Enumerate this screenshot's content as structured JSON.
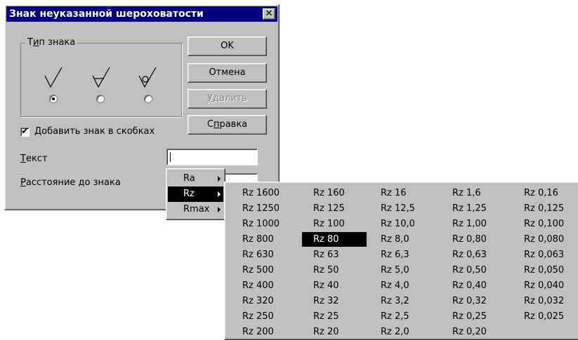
{
  "dialog": {
    "title": "Знак неуказанной шероховатости",
    "close_glyph": "✕",
    "group": {
      "label_before": "Т",
      "label_accel": "и",
      "label_after": "п знака",
      "selected_index": 0
    },
    "buttons": {
      "ok": "OK",
      "cancel": "Отмена",
      "delete_accel": "У",
      "delete_rest": "далить",
      "help_before": "С",
      "help_accel": "п",
      "help_after": "равка"
    },
    "checkbox": {
      "checked": true,
      "mark": "✔",
      "label_accel": "Д",
      "label_rest": "обавить знак в скобках"
    },
    "text_field": {
      "label_accel": "Т",
      "label_rest": "екст",
      "value": ""
    },
    "distance_field": {
      "label_accel": "Р",
      "label_rest": "асстояние до знака",
      "value": ""
    }
  },
  "menu": {
    "items": [
      "Ra",
      "Rz",
      "Rmax"
    ],
    "selected": "Rz"
  },
  "submenu": {
    "selected": "Rz 80",
    "columns": [
      [
        "Rz 1600",
        "Rz 1250",
        "Rz 1000",
        "Rz 800",
        "Rz 630",
        "Rz 500",
        "Rz 400",
        "Rz 320",
        "Rz 250",
        "Rz 200"
      ],
      [
        "Rz 160",
        "Rz 125",
        "Rz 100",
        "Rz 80",
        "Rz 63",
        "Rz 50",
        "Rz 40",
        "Rz 32",
        "Rz 25",
        "Rz 20"
      ],
      [
        "Rz 16",
        "Rz 12,5",
        "Rz 10,0",
        "Rz 8,0",
        "Rz 6,3",
        "Rz 5,0",
        "Rz 4,0",
        "Rz 3,2",
        "Rz 2,5",
        "Rz 2,0"
      ],
      [
        "Rz 1,6",
        "Rz 1,25",
        "Rz 1,00",
        "Rz 0,80",
        "Rz 0,63",
        "Rz 0,50",
        "Rz 0,40",
        "Rz 0,32",
        "Rz 0,25",
        "Rz 0,20"
      ],
      [
        "Rz 0,16",
        "Rz 0,125",
        "Rz 0,100",
        "Rz 0,080",
        "Rz 0,063",
        "Rz 0,050",
        "Rz 0,040",
        "Rz 0,032",
        "Rz 0,025"
      ]
    ]
  },
  "colors": {
    "face": "#c0c0c0",
    "title_bar": "#000080",
    "highlight": "#000000"
  }
}
